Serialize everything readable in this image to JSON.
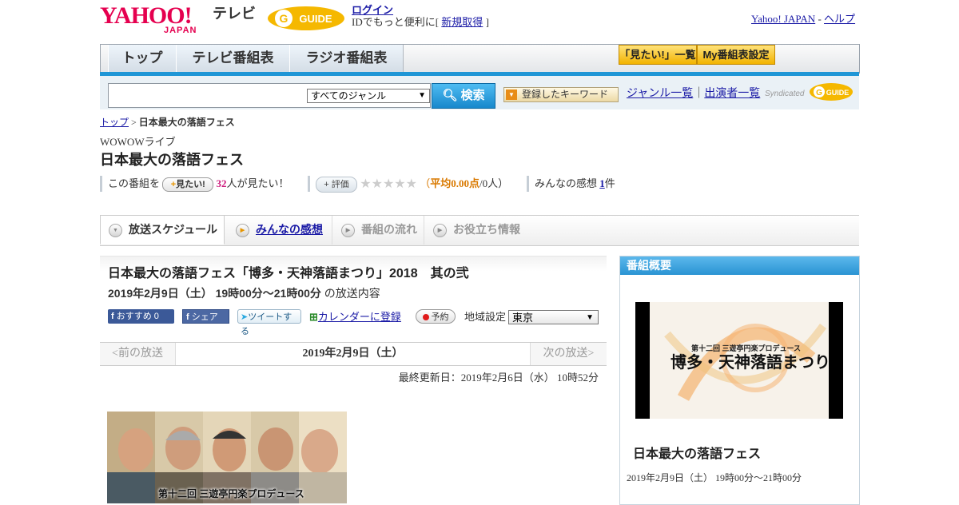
{
  "header": {
    "yahoo_logo": "YAHOO!",
    "yahoo_japan": "JAPAN",
    "tv_label": "テレビ",
    "gguide_logo": "G-GUIDE",
    "login": "ログイン",
    "login_sub_prefix": "IDでもっと便利に[ ",
    "signup": "新規取得",
    "login_sub_suffix": " ]",
    "yahoo_japan_link": "Yahoo! JAPAN",
    "separator": " - ",
    "help": "ヘルプ"
  },
  "nav": {
    "tabs": [
      "トップ",
      "テレビ番組表",
      "ラジオ番組表"
    ],
    "mitai_list": "「見たい!」一覧",
    "my_bangumi": "My番組表設定"
  },
  "search": {
    "genre_selected": "すべてのジャンル",
    "button": "検索",
    "keyword_button": "登録したキーワード",
    "genre_list": "ジャンル一覧",
    "divider": "｜",
    "performer_list": "出演者一覧",
    "syndicated": "Syndicated",
    "gguide_small": "G-GUIDE"
  },
  "breadcrumb": {
    "top": "トップ",
    "sep": " > ",
    "current": "日本最大の落語フェス"
  },
  "program": {
    "channel": "WOWOWライブ",
    "title": "日本最大の落語フェス",
    "mitai_prefix": "この番組を",
    "mitai_button": "見たい!",
    "mitai_count": "32",
    "mitai_suffix": "人が見たい！",
    "hyoka_button": "評価",
    "stars": "★★★★★",
    "avg_open": "（",
    "avg_label": "平均0.00点",
    "avg_suffix": "/0人）",
    "kansou_prefix": "みんなの感想 ",
    "kansou_count": "1",
    "kansou_suffix": "件"
  },
  "tabs": {
    "schedule": "放送スケジュール",
    "reviews": "みんなの感想",
    "flow": "番組の流れ",
    "info": "お役立ち情報"
  },
  "episode": {
    "title": "日本最大の落語フェス「博多・天神落語まつり」2018　其の弐",
    "datetime": "2019年2月9日（土） 19時00分～21時00分",
    "datetime_suffix": " の放送内容",
    "fb_recommend": "おすすめ 0",
    "fb_share": "シェア",
    "tweet": "ツイートする",
    "calendar": "カレンダーに登録",
    "reserve": "予約",
    "region_label": "地域設定",
    "region_value": "東京"
  },
  "pager": {
    "prev": "<前の放送",
    "current": "2019年2月9日（土）",
    "next": "次の放送>"
  },
  "updated": "最終更新日：2019年2月6日（水） 10時52分",
  "photo": {
    "caption": "第十二回 三遊亭円楽プロデュース"
  },
  "side": {
    "header": "番組概要",
    "image_sub": "第十二回 三遊亭円楽プロデュース",
    "image_main": "博多・天神落語まつり",
    "title": "日本最大の落語フェス",
    "date": "2019年2月9日（土） 19時00分～21時00分"
  },
  "colors": {
    "yahoo_red": "#e5004f",
    "nav_blue": "#1f96d6",
    "link": "#1a1aa6",
    "gguide_yellow": "#f5b800",
    "accent_orange": "#d97900"
  }
}
